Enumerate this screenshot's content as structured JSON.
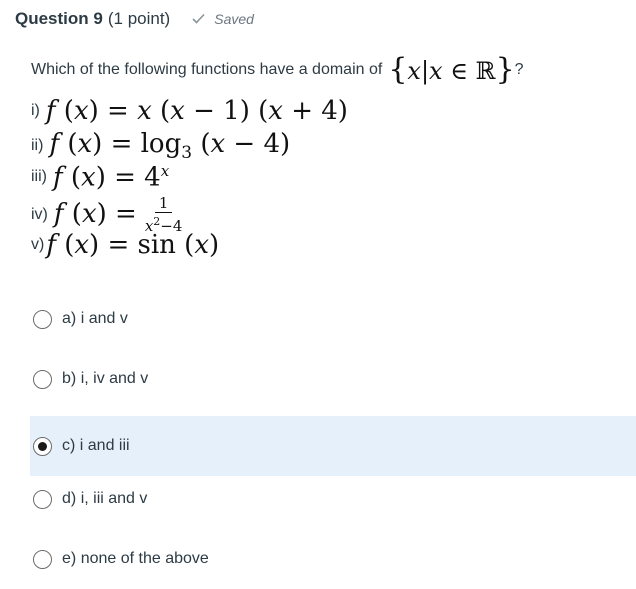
{
  "question": {
    "title": "Question 9",
    "points": "(1 point)",
    "status": "Saved",
    "prompt_prefix": "Which of the following functions have a domain of",
    "prompt_suffix": "?"
  },
  "functions": [
    {
      "label": "i)"
    },
    {
      "label": "ii)"
    },
    {
      "label": "iii)"
    },
    {
      "label": "iv)"
    },
    {
      "label": "v)"
    }
  ],
  "options": [
    {
      "letter": "a)",
      "text": "i and v",
      "selected": false
    },
    {
      "letter": "b)",
      "text": "i, iv and v",
      "selected": false
    },
    {
      "letter": "c)",
      "text": "i and iii",
      "selected": true
    },
    {
      "letter": "d)",
      "text": "i, iii and v",
      "selected": false
    },
    {
      "letter": "e)",
      "text": "none of the above",
      "selected": false
    }
  ],
  "colors": {
    "selected_bg": "#e6f0fb",
    "saved_text": "#6b7780"
  },
  "icons": {
    "saved": "check-icon"
  }
}
